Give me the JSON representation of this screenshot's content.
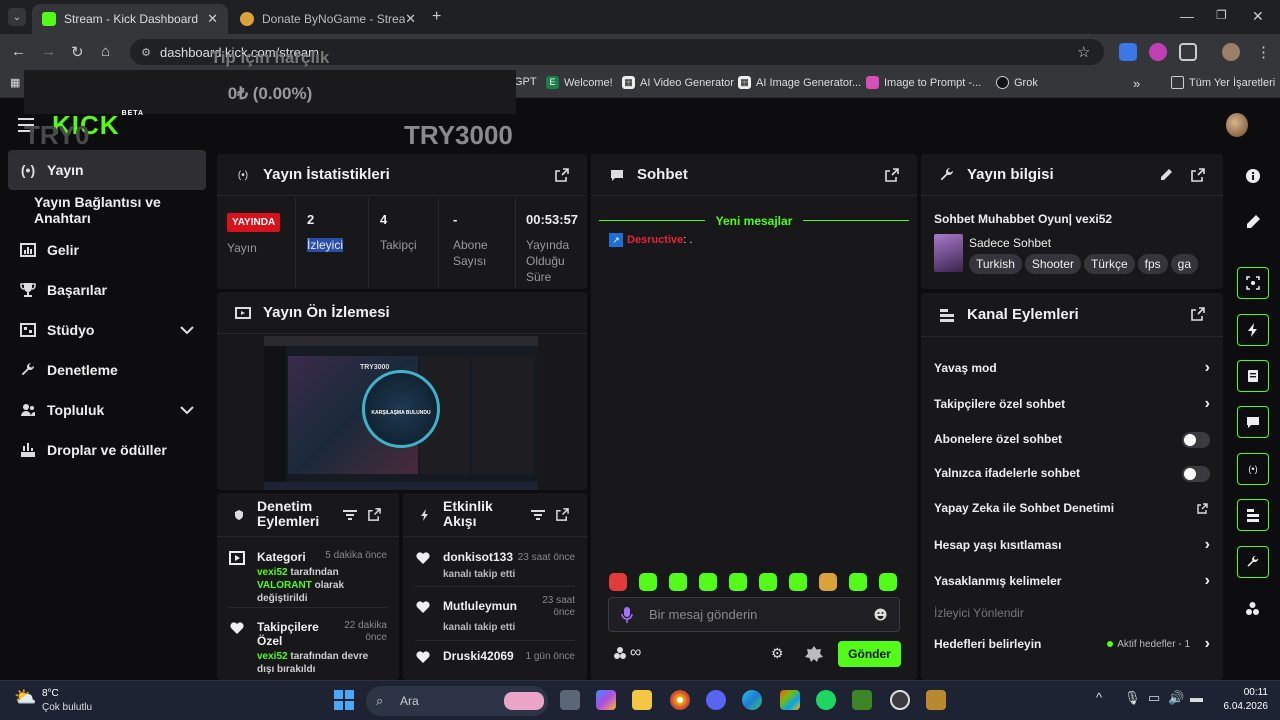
{
  "browser": {
    "tabs": [
      {
        "title": "Stream - Kick Dashboard",
        "active": true
      },
      {
        "title": "Donate ByNoGame - Streamer",
        "active": false
      }
    ],
    "url": "dashboard.kick.com/stream",
    "bookmarks": [
      "GPT",
      "Welcome!",
      "AI Video Generator",
      "AI Image Generator...",
      "Image to Prompt -...",
      "Grok"
    ],
    "bookmarks_folder": "Tüm Yer İşaretleri",
    "more_bookmarks": "»"
  },
  "overlay": {
    "title": "Tip için harçlık",
    "value": "0₺ (0.00%)",
    "left_label": "TRY0",
    "right_label": "TRY3000"
  },
  "header": {
    "logo": "KICK",
    "logo_badge": "BETA"
  },
  "sidebar": {
    "items": [
      {
        "label": "Yayın",
        "icon": "broadcast-icon"
      },
      {
        "label": "Yayın Bağlantısı ve Anahtarı"
      },
      {
        "label": "Gelir",
        "icon": "chart-icon"
      },
      {
        "label": "Başarılar",
        "icon": "trophy-icon"
      },
      {
        "label": "Stüdyo",
        "icon": "studio-icon"
      },
      {
        "label": "Denetleme",
        "icon": "wrench-icon"
      },
      {
        "label": "Topluluk",
        "icon": "community-icon"
      },
      {
        "label": "Droplar ve ödüller",
        "icon": "gift-icon"
      }
    ]
  },
  "stats": {
    "title": "Yayın İstatistikleri",
    "live_badge": "YAYINDA",
    "live_label": "Yayın",
    "viewers_value": "2",
    "viewers_label": "İzleyici",
    "followers_value": "4",
    "followers_label": "Takipçi",
    "subs_value": "-",
    "subs_label": "Abone Sayısı",
    "uptime_value": "00:53:57",
    "uptime_label": "Yayında Olduğu Süre"
  },
  "preview": {
    "title": "Yayın Ön İzlemesi",
    "thumb_top": "TRY3000",
    "thumb_center": "KARŞILAŞMA BULUNDU"
  },
  "moderation": {
    "title": "Denetim Eylemleri",
    "entries": [
      {
        "heading": "Kategori",
        "time": "5 dakika önce",
        "user": "vexi52",
        "text1": " tarafından",
        "highlight": "VALORANT",
        "text2": " olarak değiştirildi"
      },
      {
        "heading": "Takipçilere Özel",
        "time": "22 dakika önce",
        "user": "vexi52",
        "text1": " tarafından devre dışı bırakıldı"
      }
    ]
  },
  "activity": {
    "title": "Etkinlik Akışı",
    "entries": [
      {
        "user": "donkisot133",
        "time": "23 saat önce",
        "text": "kanalı takip etti"
      },
      {
        "user": "Mutluleymun",
        "time": "23 saat önce",
        "text": "kanalı takip etti"
      },
      {
        "user": "Druski42069",
        "time": "1 gün önce",
        "text": ""
      }
    ]
  },
  "chat": {
    "title": "Sohbet",
    "new_messages": "Yeni mesajlar",
    "message_user": "Desructive",
    "message_text": ": .",
    "input_placeholder": "Bir mesaj gönderin",
    "send_label": "Gönder",
    "emote_colors": [
      "#e23b3b",
      "#53fc18",
      "#53fc18",
      "#53fc18",
      "#53fc18",
      "#53fc18",
      "#53fc18",
      "#d9a23a",
      "#53fc18",
      "#53fc18"
    ]
  },
  "stream_info": {
    "title": "Yayın bilgisi",
    "stream_title": "Sohbet Muhabbet Oyun| vexi52",
    "category": "Sadece Sohbet",
    "tags": [
      "Turkish",
      "Shooter",
      "Türkçe",
      "fps",
      "ga"
    ]
  },
  "channel_actions": {
    "title": "Kanal Eylemleri",
    "rows": [
      {
        "label": "Yavaş mod",
        "type": "arrow"
      },
      {
        "label": "Takipçilere özel sohbet",
        "type": "arrow"
      },
      {
        "label": "Abonelere özel sohbet",
        "type": "toggle"
      },
      {
        "label": "Yalnızca ifadelerle sohbet",
        "type": "toggle"
      },
      {
        "label": "Yapay Zeka ile Sohbet Denetimi",
        "type": "external"
      },
      {
        "label": "Hesap yaşı kısıtlaması",
        "type": "arrow"
      },
      {
        "label": "Yasaklanmış kelimeler",
        "type": "arrow"
      },
      {
        "label": "İzleyici Yönlendir",
        "type": "none"
      },
      {
        "label": "Hedefleri belirleyin",
        "type": "arrow"
      }
    ],
    "goal_status": "Aktif hedefler - 1"
  },
  "taskbar": {
    "temp": "8°C",
    "weather": "Çok bulutlu",
    "search": "Ara",
    "time": "00:11",
    "date": "6.04.2026"
  },
  "colors": {
    "accent": "#53fc18",
    "live": "#d6121c",
    "panel": "#18181b"
  }
}
